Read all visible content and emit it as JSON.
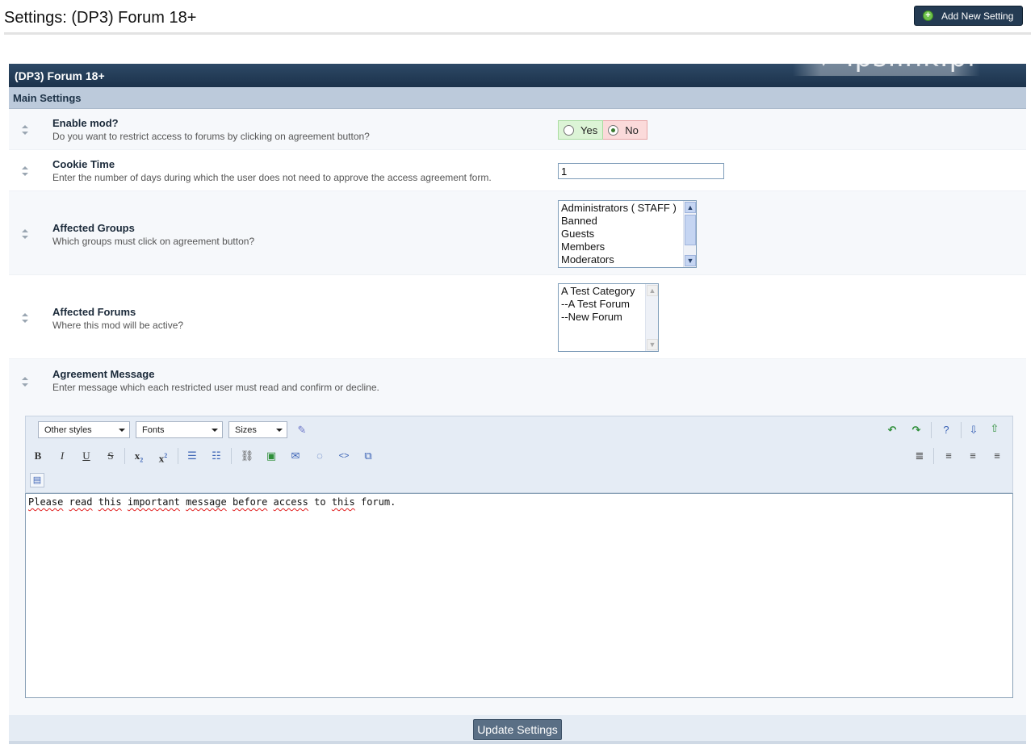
{
  "page": {
    "title": "Settings: (DP3) Forum 18+"
  },
  "header": {
    "add_button_label": "Add New Setting"
  },
  "watermark": {
    "text": "ipslink.pl"
  },
  "panel": {
    "title": "(DP3) Forum 18+",
    "section": "Main Settings"
  },
  "settings": {
    "enable_mod": {
      "name": "Enable mod?",
      "desc": "Do you want to restrict access to forums by clicking on agreement button?",
      "yes_label": "Yes",
      "no_label": "No",
      "selected": "No"
    },
    "cookie_time": {
      "name": "Cookie Time",
      "desc": "Enter the number of days during which the user does not need to approve the access agreement form.",
      "value": "1"
    },
    "affected_groups": {
      "name": "Affected Groups",
      "desc": "Which groups must click on agreement button?",
      "options": [
        "Administrators ( STAFF )",
        "Banned",
        "Guests",
        "Members",
        "Moderators"
      ]
    },
    "affected_forums": {
      "name": "Affected Forums",
      "desc": "Where this mod will be active?",
      "options": [
        "A Test Category",
        "--A Test Forum",
        "--New Forum"
      ]
    },
    "agreement_message": {
      "name": "Agreement Message",
      "desc": "Enter message which each restricted user must read and confirm or decline."
    }
  },
  "editor": {
    "style_select": "Other styles",
    "font_select": "Fonts",
    "size_select": "Sizes",
    "content_words": [
      "Please",
      "read",
      "this",
      "important",
      "message",
      "before",
      "access",
      "to",
      "this",
      "forum."
    ]
  },
  "footer": {
    "update_label": "Update Settings"
  },
  "colors": {
    "header_dark": "#1c324b",
    "subheader": "#bccadb",
    "button": "#5a6f85",
    "add_button": "#243b53"
  }
}
